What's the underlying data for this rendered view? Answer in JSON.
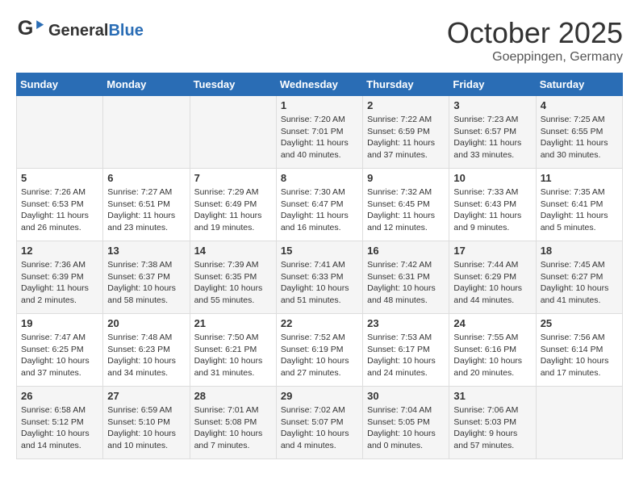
{
  "header": {
    "logo_line1": "General",
    "logo_line2": "Blue",
    "month": "October 2025",
    "location": "Goeppingen, Germany"
  },
  "weekdays": [
    "Sunday",
    "Monday",
    "Tuesday",
    "Wednesday",
    "Thursday",
    "Friday",
    "Saturday"
  ],
  "weeks": [
    [
      {
        "day": "",
        "info": ""
      },
      {
        "day": "",
        "info": ""
      },
      {
        "day": "",
        "info": ""
      },
      {
        "day": "1",
        "info": "Sunrise: 7:20 AM\nSunset: 7:01 PM\nDaylight: 11 hours\nand 40 minutes."
      },
      {
        "day": "2",
        "info": "Sunrise: 7:22 AM\nSunset: 6:59 PM\nDaylight: 11 hours\nand 37 minutes."
      },
      {
        "day": "3",
        "info": "Sunrise: 7:23 AM\nSunset: 6:57 PM\nDaylight: 11 hours\nand 33 minutes."
      },
      {
        "day": "4",
        "info": "Sunrise: 7:25 AM\nSunset: 6:55 PM\nDaylight: 11 hours\nand 30 minutes."
      }
    ],
    [
      {
        "day": "5",
        "info": "Sunrise: 7:26 AM\nSunset: 6:53 PM\nDaylight: 11 hours\nand 26 minutes."
      },
      {
        "day": "6",
        "info": "Sunrise: 7:27 AM\nSunset: 6:51 PM\nDaylight: 11 hours\nand 23 minutes."
      },
      {
        "day": "7",
        "info": "Sunrise: 7:29 AM\nSunset: 6:49 PM\nDaylight: 11 hours\nand 19 minutes."
      },
      {
        "day": "8",
        "info": "Sunrise: 7:30 AM\nSunset: 6:47 PM\nDaylight: 11 hours\nand 16 minutes."
      },
      {
        "day": "9",
        "info": "Sunrise: 7:32 AM\nSunset: 6:45 PM\nDaylight: 11 hours\nand 12 minutes."
      },
      {
        "day": "10",
        "info": "Sunrise: 7:33 AM\nSunset: 6:43 PM\nDaylight: 11 hours\nand 9 minutes."
      },
      {
        "day": "11",
        "info": "Sunrise: 7:35 AM\nSunset: 6:41 PM\nDaylight: 11 hours\nand 5 minutes."
      }
    ],
    [
      {
        "day": "12",
        "info": "Sunrise: 7:36 AM\nSunset: 6:39 PM\nDaylight: 11 hours\nand 2 minutes."
      },
      {
        "day": "13",
        "info": "Sunrise: 7:38 AM\nSunset: 6:37 PM\nDaylight: 10 hours\nand 58 minutes."
      },
      {
        "day": "14",
        "info": "Sunrise: 7:39 AM\nSunset: 6:35 PM\nDaylight: 10 hours\nand 55 minutes."
      },
      {
        "day": "15",
        "info": "Sunrise: 7:41 AM\nSunset: 6:33 PM\nDaylight: 10 hours\nand 51 minutes."
      },
      {
        "day": "16",
        "info": "Sunrise: 7:42 AM\nSunset: 6:31 PM\nDaylight: 10 hours\nand 48 minutes."
      },
      {
        "day": "17",
        "info": "Sunrise: 7:44 AM\nSunset: 6:29 PM\nDaylight: 10 hours\nand 44 minutes."
      },
      {
        "day": "18",
        "info": "Sunrise: 7:45 AM\nSunset: 6:27 PM\nDaylight: 10 hours\nand 41 minutes."
      }
    ],
    [
      {
        "day": "19",
        "info": "Sunrise: 7:47 AM\nSunset: 6:25 PM\nDaylight: 10 hours\nand 37 minutes."
      },
      {
        "day": "20",
        "info": "Sunrise: 7:48 AM\nSunset: 6:23 PM\nDaylight: 10 hours\nand 34 minutes."
      },
      {
        "day": "21",
        "info": "Sunrise: 7:50 AM\nSunset: 6:21 PM\nDaylight: 10 hours\nand 31 minutes."
      },
      {
        "day": "22",
        "info": "Sunrise: 7:52 AM\nSunset: 6:19 PM\nDaylight: 10 hours\nand 27 minutes."
      },
      {
        "day": "23",
        "info": "Sunrise: 7:53 AM\nSunset: 6:17 PM\nDaylight: 10 hours\nand 24 minutes."
      },
      {
        "day": "24",
        "info": "Sunrise: 7:55 AM\nSunset: 6:16 PM\nDaylight: 10 hours\nand 20 minutes."
      },
      {
        "day": "25",
        "info": "Sunrise: 7:56 AM\nSunset: 6:14 PM\nDaylight: 10 hours\nand 17 minutes."
      }
    ],
    [
      {
        "day": "26",
        "info": "Sunrise: 6:58 AM\nSunset: 5:12 PM\nDaylight: 10 hours\nand 14 minutes."
      },
      {
        "day": "27",
        "info": "Sunrise: 6:59 AM\nSunset: 5:10 PM\nDaylight: 10 hours\nand 10 minutes."
      },
      {
        "day": "28",
        "info": "Sunrise: 7:01 AM\nSunset: 5:08 PM\nDaylight: 10 hours\nand 7 minutes."
      },
      {
        "day": "29",
        "info": "Sunrise: 7:02 AM\nSunset: 5:07 PM\nDaylight: 10 hours\nand 4 minutes."
      },
      {
        "day": "30",
        "info": "Sunrise: 7:04 AM\nSunset: 5:05 PM\nDaylight: 10 hours\nand 0 minutes."
      },
      {
        "day": "31",
        "info": "Sunrise: 7:06 AM\nSunset: 5:03 PM\nDaylight: 9 hours\nand 57 minutes."
      },
      {
        "day": "",
        "info": ""
      }
    ]
  ]
}
